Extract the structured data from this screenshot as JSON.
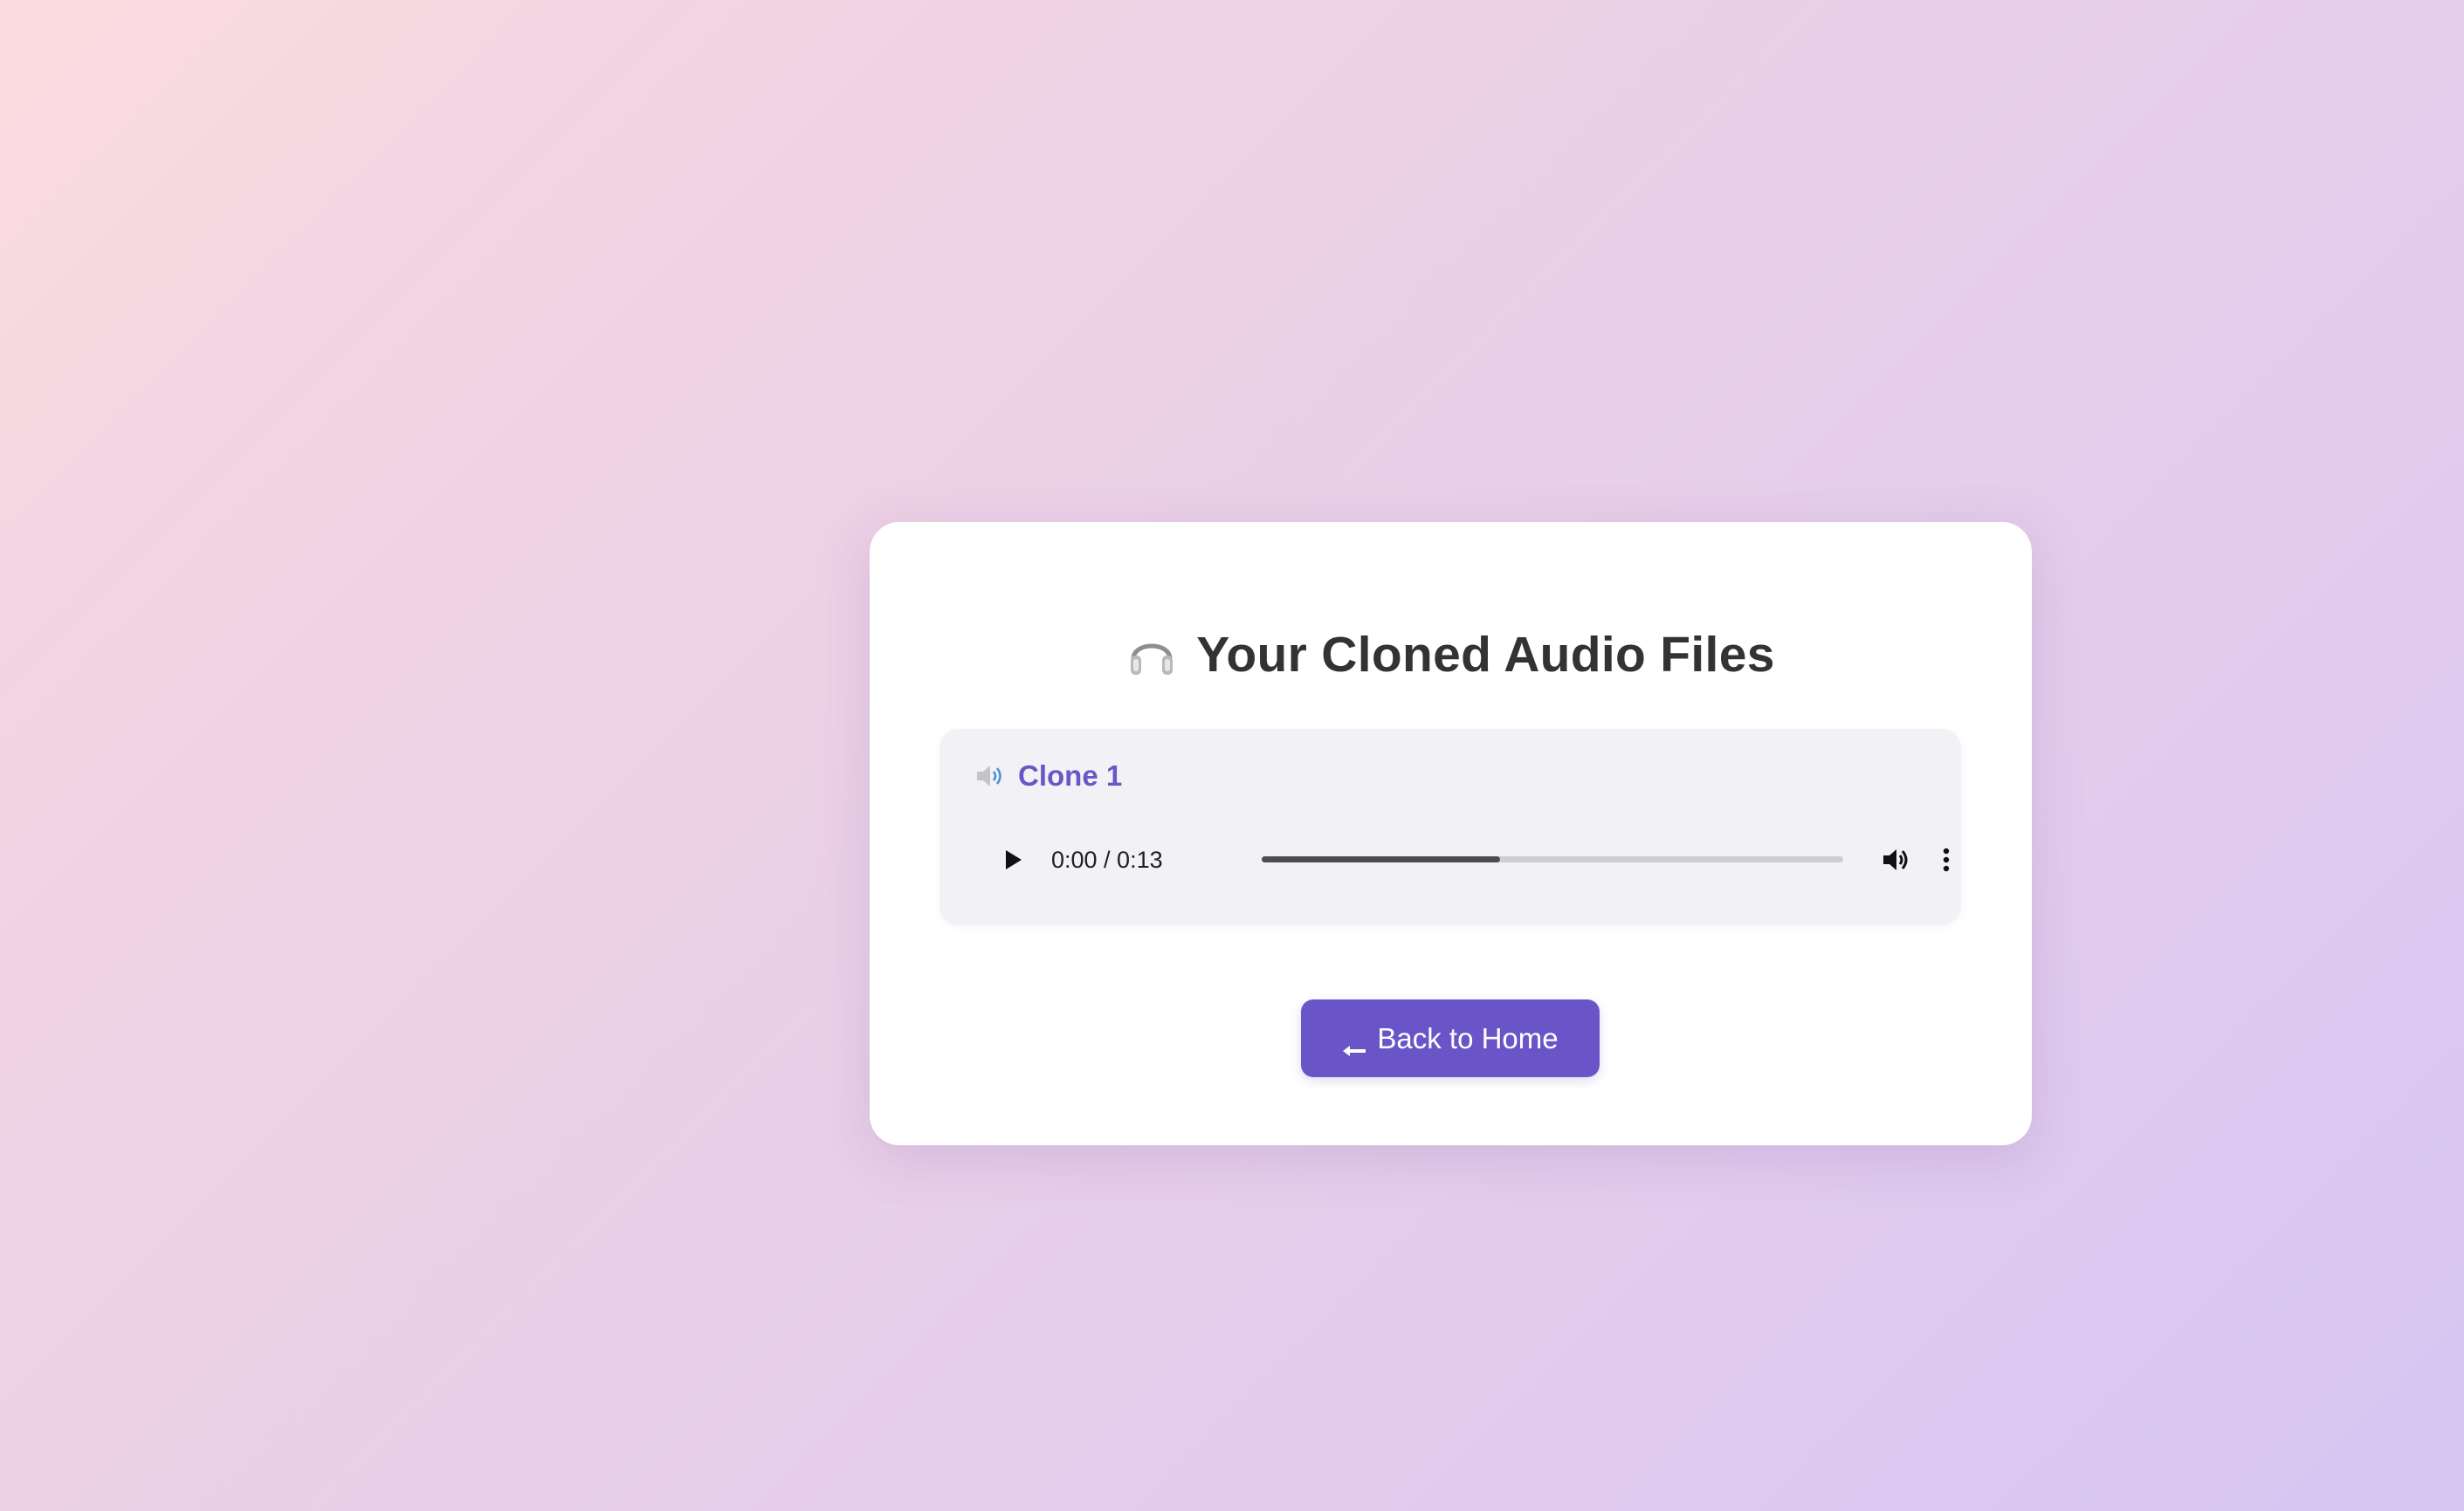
{
  "page": {
    "title": "Your Cloned Audio Files",
    "title_icon": "headphones-icon"
  },
  "clips": [
    {
      "label": "Clone 1",
      "icon": "speaker-icon",
      "player": {
        "current_time": "0:00",
        "separator": " / ",
        "duration": "0:13",
        "time_text": "0:00 / 0:13",
        "buffered_fraction": 0.41
      }
    }
  ],
  "back_button": {
    "label": "Back to Home",
    "icon": "arrow-left-icon"
  },
  "colors": {
    "accent": "#6a55c8",
    "clip_label": "#6a56c6",
    "title": "#333333"
  }
}
